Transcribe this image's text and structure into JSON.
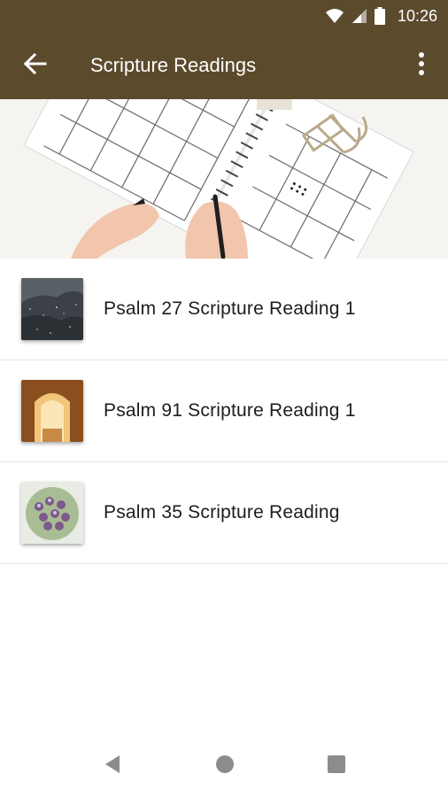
{
  "status_bar": {
    "time": "10:26",
    "icons": [
      "wifi-icon",
      "cell-signal-icon",
      "battery-icon"
    ]
  },
  "toolbar": {
    "title": "Scripture Readings",
    "back_icon": "arrow-left-icon",
    "menu_icon": "more-vert-icon",
    "color": "#5c4a2c"
  },
  "hero": {
    "image": "calendar-planner-with-hand-and-pen"
  },
  "readings": [
    {
      "title": "Psalm 27 Scripture Reading 1",
      "thumb": "starry-rock-thumbnail"
    },
    {
      "title": "Psalm 91 Scripture Reading 1",
      "thumb": "empty-tomb-thumbnail"
    },
    {
      "title": "Psalm 35 Scripture Reading",
      "thumb": "purple-flowers-thumbnail"
    }
  ],
  "nav_bar": {
    "icons": [
      "back-triangle-icon",
      "home-circle-icon",
      "recents-square-icon"
    ]
  }
}
